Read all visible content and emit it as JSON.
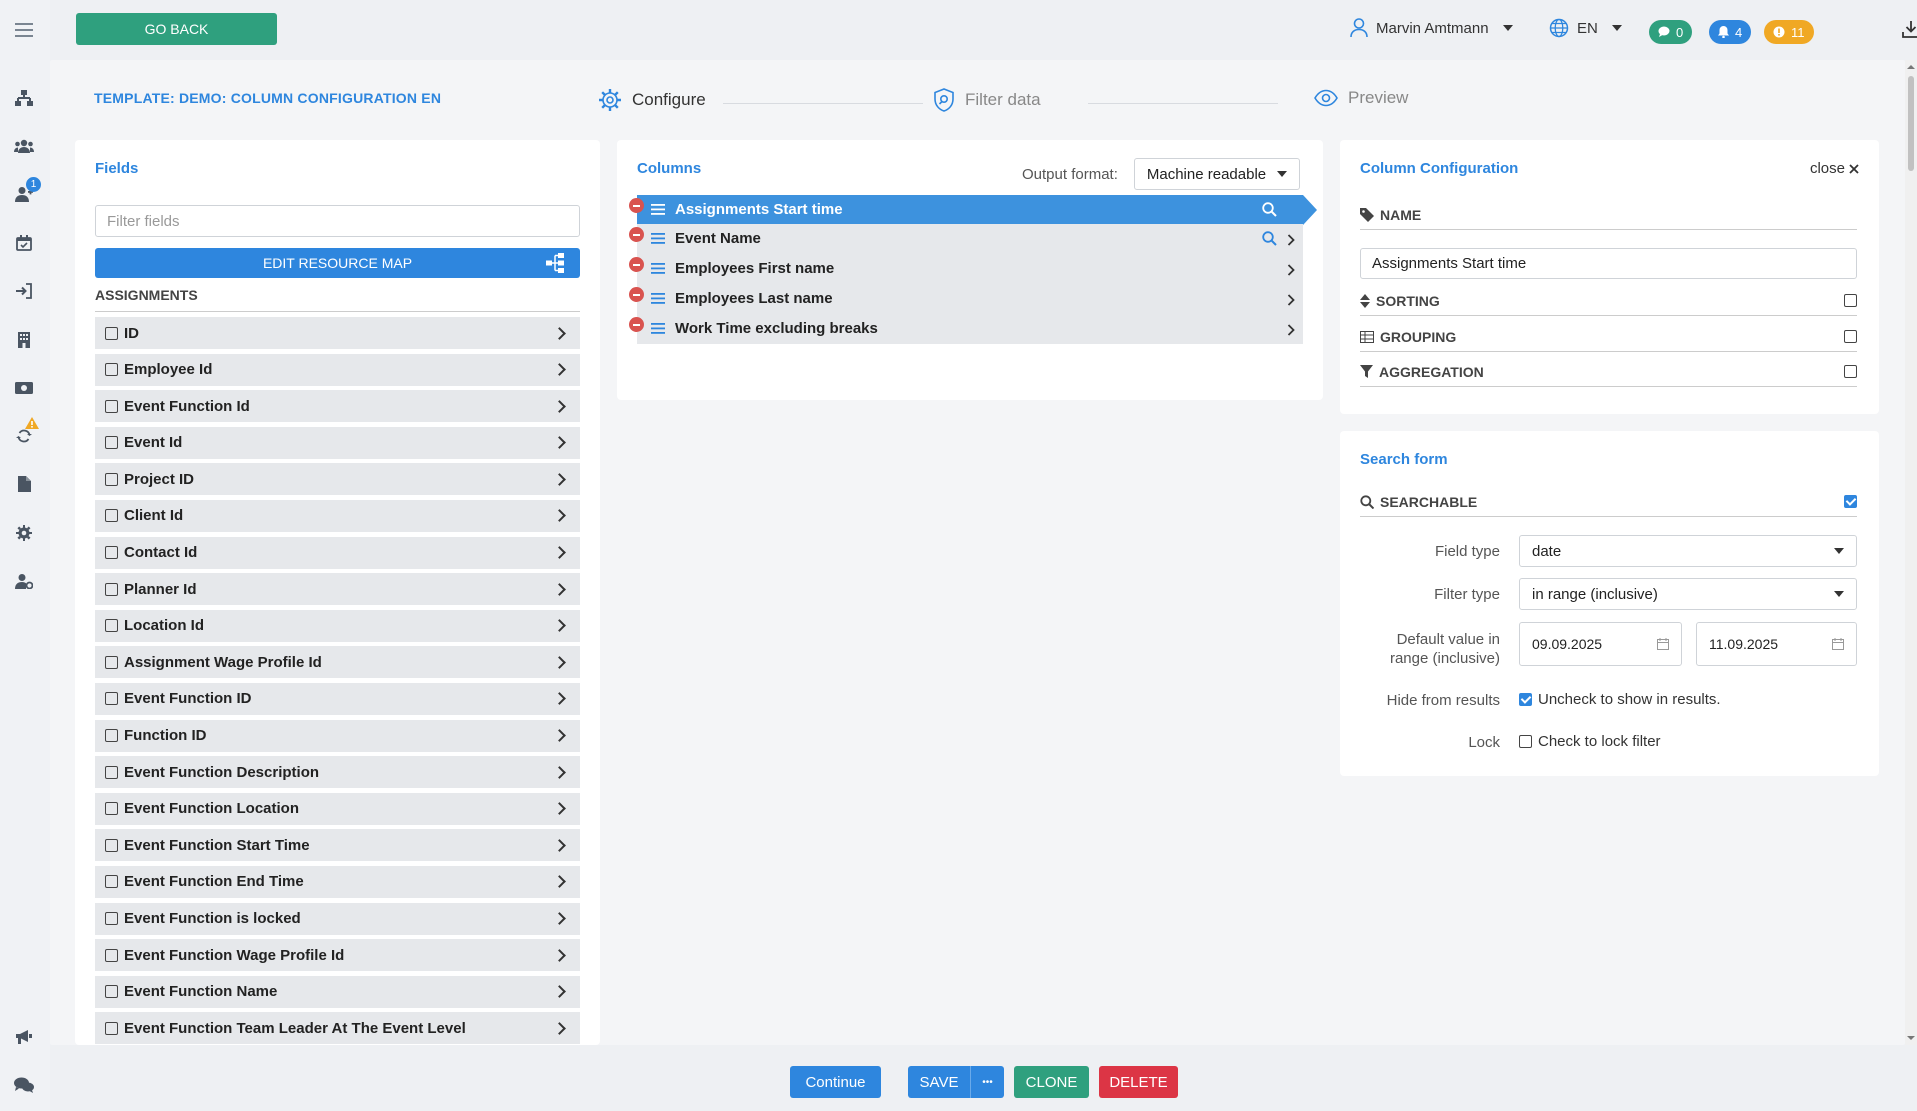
{
  "topbar": {
    "go_back": "GO BACK",
    "user_name": "Marvin Amtmann",
    "language": "EN",
    "messages_count": "0",
    "notifications_count": "4",
    "alerts_count": "11"
  },
  "sidebar": {
    "user_badge": "1"
  },
  "template_title": "TEMPLATE: DEMO: COLUMN CONFIGURATION EN",
  "steps": [
    {
      "label": "Configure"
    },
    {
      "label": "Filter data"
    },
    {
      "label": "Preview"
    }
  ],
  "fields_panel": {
    "title": "Fields",
    "filter_placeholder": "Filter fields",
    "edit_map_label": "EDIT RESOURCE MAP",
    "section": "ASSIGNMENTS",
    "items": [
      "ID",
      "Employee Id",
      "Event Function Id",
      "Event Id",
      "Project ID",
      "Client Id",
      "Contact Id",
      "Planner Id",
      "Location Id",
      "Assignment Wage Profile Id",
      "Event Function ID",
      "Function ID",
      "Event Function Description",
      "Event Function Location",
      "Event Function Start Time",
      "Event Function End Time",
      "Event Function is locked",
      "Event Function Wage Profile Id",
      "Event Function Name",
      "Event Function Team Leader At The Event Level"
    ]
  },
  "columns_panel": {
    "title": "Columns",
    "output_format_label": "Output format:",
    "output_format_value": "Machine readable",
    "columns": [
      "Assignments Start time",
      "Event Name",
      "Employees First name",
      "Employees Last name",
      "Work Time excluding breaks"
    ]
  },
  "column_config": {
    "title": "Column Configuration",
    "close_label": "close",
    "name_label": "NAME",
    "name_value": "Assignments Start time",
    "sorting_label": "SORTING",
    "grouping_label": "GROUPING",
    "aggregation_label": "AGGREGATION"
  },
  "search_form": {
    "title": "Search form",
    "searchable_label": "SEARCHABLE",
    "field_type_label": "Field type",
    "field_type_value": "date",
    "filter_type_label": "Filter type",
    "filter_type_value": "in range (inclusive)",
    "default_value_label_1": "Default value in",
    "default_value_label_2": "range (inclusive)",
    "date_from": "09.09.2025",
    "date_to": "11.09.2025",
    "hide_label": "Hide from results",
    "hide_text": "Uncheck to show in results.",
    "lock_label": "Lock",
    "lock_text": "Check to lock filter"
  },
  "bottom": {
    "continue": "Continue",
    "save": "SAVE",
    "more": "•••",
    "clone": "CLONE",
    "delete": "DELETE"
  }
}
